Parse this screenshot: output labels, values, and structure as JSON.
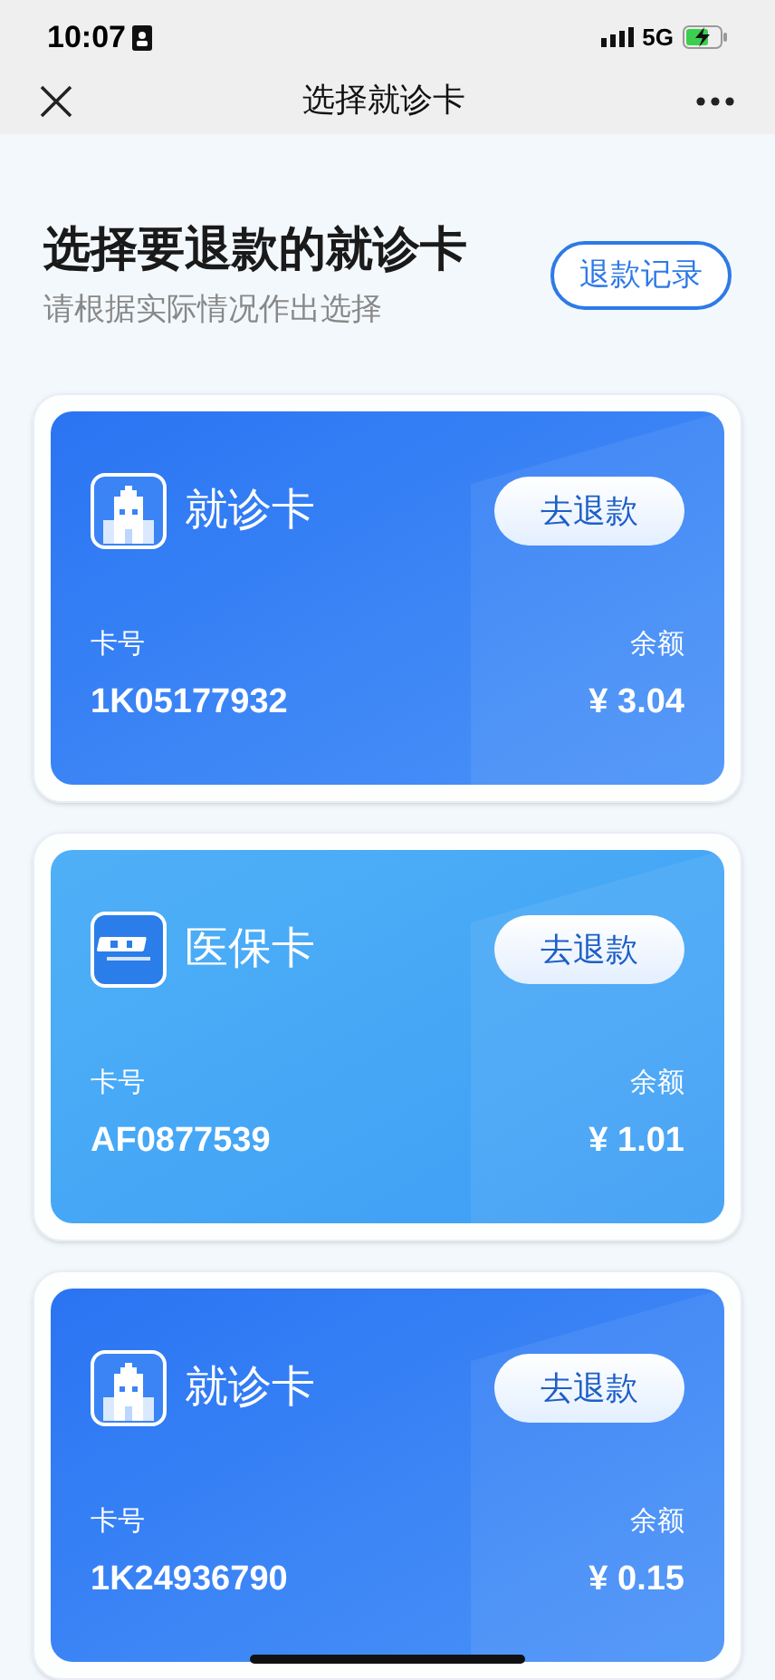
{
  "status_bar": {
    "time": "10:07",
    "network": "5G"
  },
  "nav": {
    "title": "选择就诊卡"
  },
  "header": {
    "title": "选择要退款的就诊卡",
    "subtitle": "请根据实际情况作出选择",
    "records_button": "退款记录"
  },
  "cards": [
    {
      "kind": "clinic",
      "name": "就诊卡",
      "action": "去退款",
      "number_label": "卡号",
      "number": "1K05177932",
      "balance_label": "余额",
      "balance": "¥ 3.04"
    },
    {
      "kind": "insurance",
      "name": "医保卡",
      "action": "去退款",
      "number_label": "卡号",
      "number": "AF0877539",
      "balance_label": "余额",
      "balance": "¥ 1.01"
    },
    {
      "kind": "clinic",
      "name": "就诊卡",
      "action": "去退款",
      "number_label": "卡号",
      "number": "1K24936790",
      "balance_label": "余额",
      "balance": "¥ 0.15"
    }
  ]
}
